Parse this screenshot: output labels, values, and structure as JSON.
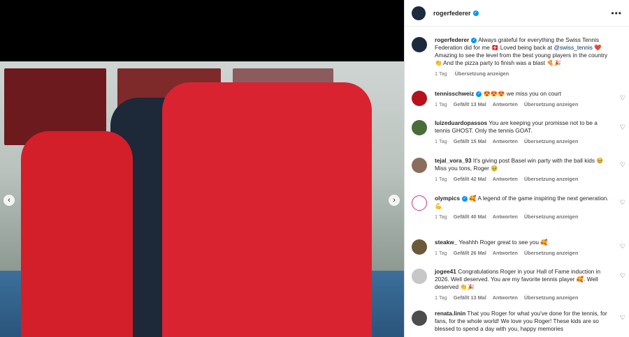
{
  "post": {
    "author": "rogerfederer",
    "media_nav": {
      "prev_icon": "‹",
      "next_icon": "›"
    },
    "more_icon": "•••",
    "caption": {
      "text": "Always grateful for everything the Swiss Tennis Federation did for me 🇨🇭 Loved being back at",
      "mention": "@swiss_tennis",
      "text2": "❤️ Amazing to see the level from the best young players in the country 👏 And the pizza party to finish was a blast 🍕🎉",
      "time": "1 Tag",
      "translate": "Übersetzung anzeigen"
    }
  },
  "comments": [
    {
      "user": "tennisschweiz",
      "verified": true,
      "text": "😍😍😍 we miss you on court",
      "time": "1 Tag",
      "likes": "Gefällt 13 Mal",
      "reply": "Antworten",
      "translate": "Übersetzung anzeigen",
      "avatar_color": "#b5121b"
    },
    {
      "user": "luizeduardopassos",
      "verified": false,
      "text": "You are keeping your promisse not to be a tennis GHOST. Only the tennis GOAT.",
      "time": "1 Tag",
      "likes": "Gefällt 15 Mal",
      "reply": "Antworten",
      "translate": "Übersetzung anzeigen",
      "avatar_color": "#4a6b3a"
    },
    {
      "user": "tejal_vora_93",
      "verified": false,
      "text": "It's giving post Basel win party with the ball kids 🥹 Miss you tons, Roger 🥹",
      "time": "1 Tag",
      "likes": "Gefällt 42 Mal",
      "reply": "Antworten",
      "translate": "Übersetzung anzeigen",
      "avatar_color": "#8a6d5c"
    },
    {
      "user": "olympics",
      "verified": true,
      "text": "🥰 A legend of the game inspiring the next generation. 💪",
      "time": "1 Tag",
      "likes": "Gefällt 40 Mal",
      "reply": "Antworten",
      "translate": "Übersetzung anzeigen",
      "avatar_color": "#ffffff"
    },
    {
      "user": "steakw_",
      "verified": false,
      "text": "Yeahhh Roger great to see you 🥰",
      "time": "1 Tag",
      "likes": "Gefällt 26 Mal",
      "reply": "Antworten",
      "translate": "Übersetzung anzeigen",
      "avatar_color": "#6b5a3a"
    },
    {
      "user": "jogee41",
      "verified": false,
      "text": "Congratulations Roger in your Hall of Fame induction in 2026. Well deserved. You are my favorite tennis player 🥰. Well deserved 👏🎉",
      "time": "1 Tag",
      "likes": "Gefällt 13 Mal",
      "reply": "Antworten",
      "translate": "Übersetzung anzeigen",
      "avatar_color": "#c7c7c7"
    },
    {
      "user": "renata.linin",
      "verified": false,
      "text": "That you Roger for what you've done for the tennis, for fans, for the whole world! We love you Roger! These kids are so blessed to spend a day with you, happy memories",
      "time": "",
      "likes": "",
      "reply": "",
      "translate": "",
      "avatar_color": "#4d4d4d"
    }
  ],
  "colors": {
    "verified": "#0095f6",
    "meta": "#737373",
    "mention": "#00376b"
  }
}
